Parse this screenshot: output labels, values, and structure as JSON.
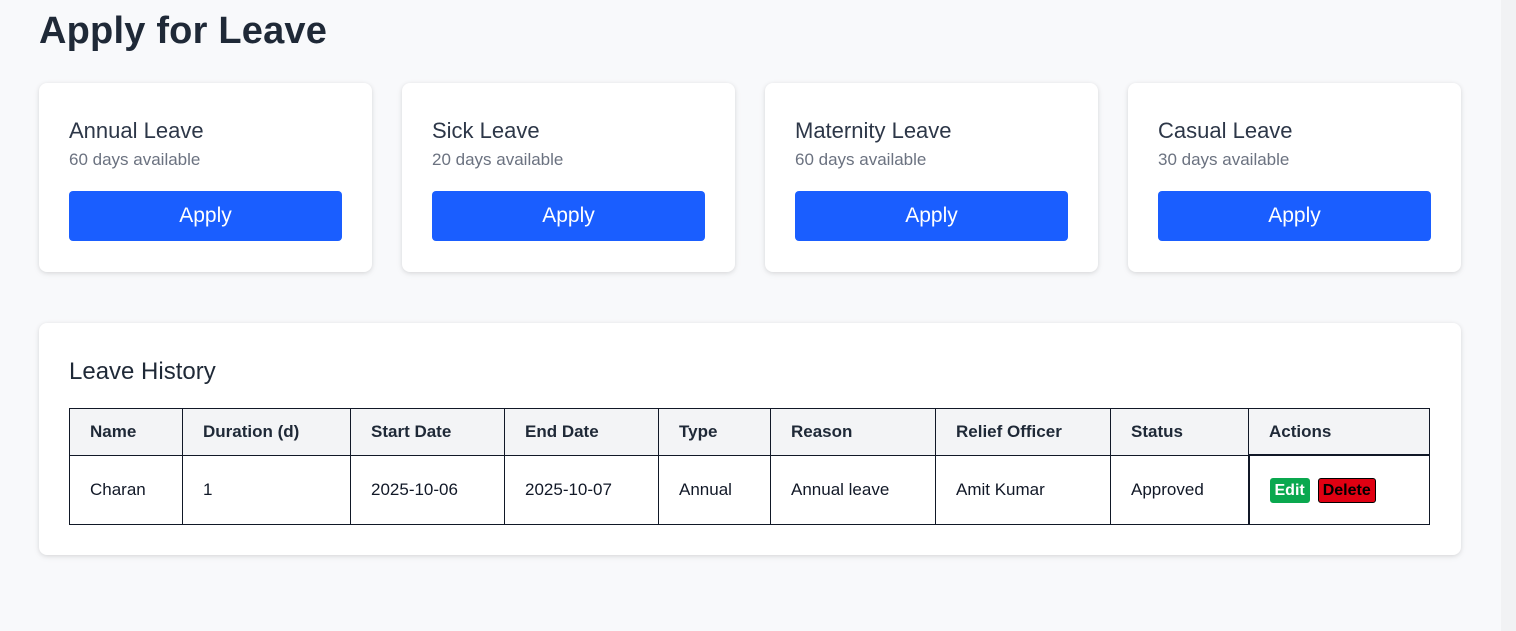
{
  "page": {
    "title": "Apply for Leave"
  },
  "leave_types": [
    {
      "name": "Annual Leave",
      "available": "60 days available",
      "button": "Apply"
    },
    {
      "name": "Sick Leave",
      "available": "20 days available",
      "button": "Apply"
    },
    {
      "name": "Maternity Leave",
      "available": "60 days available",
      "button": "Apply"
    },
    {
      "name": "Casual Leave",
      "available": "30 days available",
      "button": "Apply"
    }
  ],
  "history": {
    "title": "Leave History",
    "columns": [
      "Name",
      "Duration (d)",
      "Start Date",
      "End Date",
      "Type",
      "Reason",
      "Relief Officer",
      "Status",
      "Actions"
    ],
    "rows": [
      {
        "name": "Charan",
        "duration": "1",
        "start_date": "2025-10-06",
        "end_date": "2025-10-07",
        "type": "Annual",
        "reason": "Annual leave",
        "relief_officer": "Amit Kumar",
        "status": "Approved",
        "edit_label": "Edit",
        "delete_label": "Delete"
      }
    ]
  },
  "colors": {
    "primary": "#1a5eff",
    "edit": "#0aa84f",
    "delete": "#e00012",
    "background": "#f8f9fb"
  }
}
